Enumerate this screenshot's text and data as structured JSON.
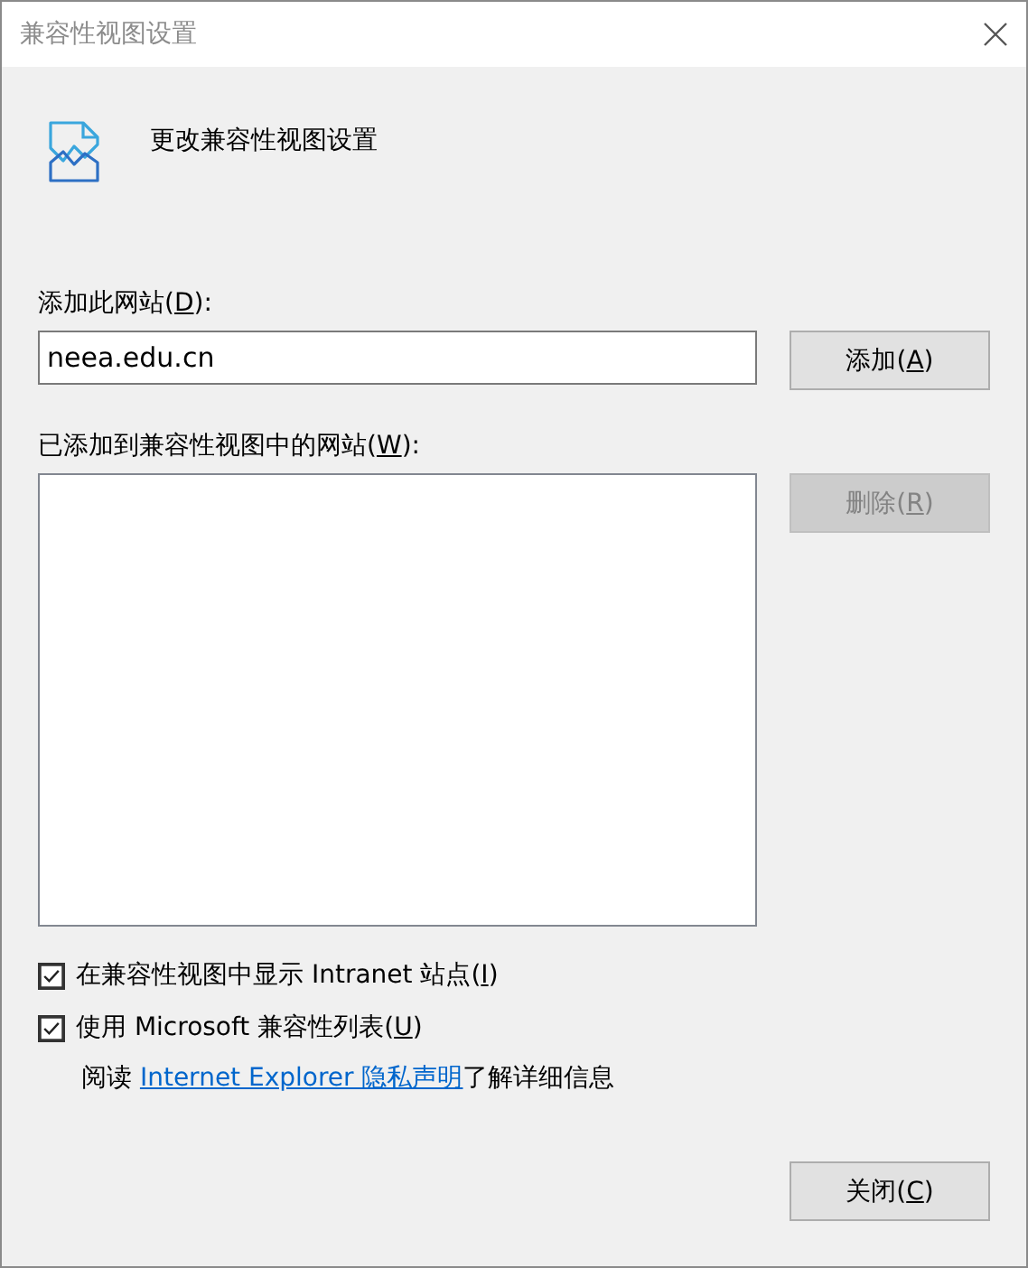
{
  "window": {
    "title": "兼容性视图设置"
  },
  "header": {
    "title": "更改兼容性视图设置"
  },
  "add_site": {
    "label": "添加此网站(",
    "access_key": "D",
    "label_end": "):",
    "value": "neea.edu.cn"
  },
  "add_button": {
    "label": "添加(",
    "access_key": "A",
    "label_end": ")",
    "disabled": false
  },
  "site_list": {
    "label": "已添加到兼容性视图中的网站(",
    "access_key": "W",
    "label_end": "):"
  },
  "remove_button": {
    "label": "删除(",
    "access_key": "R",
    "label_end": ")",
    "disabled": true
  },
  "checkboxes": [
    {
      "label": "在兼容性视图中显示 Intranet 站点(",
      "access_key": "I",
      "label_end": ")",
      "checked": true
    },
    {
      "label": "使用 Microsoft 兼容性列表(",
      "access_key": "U",
      "label_end": ")",
      "checked": true
    }
  ],
  "privacy": {
    "before": "阅读 ",
    "link": "Internet Explorer 隐私声明",
    "after": "了解详细信息"
  },
  "close_button": {
    "label": "关闭(",
    "access_key": "C",
    "label_end": ")",
    "disabled": false
  }
}
